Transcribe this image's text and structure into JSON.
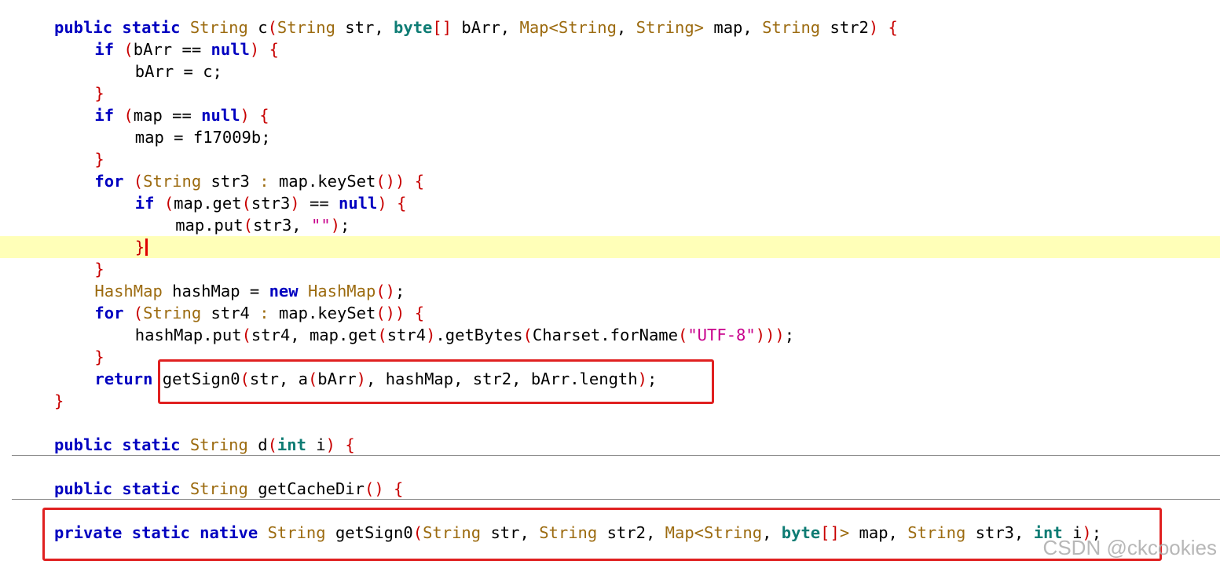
{
  "editor": {
    "highlight_line": 10,
    "caret_line": 10,
    "lines": [
      {
        "indent": 1,
        "tokens": [
          [
            "kw",
            "public"
          ],
          [
            "pl",
            " "
          ],
          [
            "kw",
            "static"
          ],
          [
            "pl",
            " "
          ],
          [
            "ty",
            "String"
          ],
          [
            "pl",
            " c"
          ],
          [
            "br",
            "("
          ],
          [
            "ty",
            "String"
          ],
          [
            "pl",
            " str, "
          ],
          [
            "pr",
            "byte"
          ],
          [
            "br",
            "[]"
          ],
          [
            "pl",
            " bArr, "
          ],
          [
            "ty",
            "Map<String"
          ],
          [
            "pl",
            ", "
          ],
          [
            "ty",
            "String>"
          ],
          [
            "pl",
            " map, "
          ],
          [
            "ty",
            "String"
          ],
          [
            "pl",
            " str2"
          ],
          [
            "br",
            ")"
          ],
          [
            "pl",
            " "
          ],
          [
            "br",
            "{"
          ]
        ]
      },
      {
        "indent": 2,
        "tokens": [
          [
            "kw",
            "if"
          ],
          [
            "pl",
            " "
          ],
          [
            "br",
            "("
          ],
          [
            "pl",
            "bArr == "
          ],
          [
            "kw",
            "null"
          ],
          [
            "br",
            ")"
          ],
          [
            "pl",
            " "
          ],
          [
            "br",
            "{"
          ]
        ]
      },
      {
        "indent": 3,
        "tokens": [
          [
            "pl",
            "bArr = c;"
          ]
        ]
      },
      {
        "indent": 2,
        "tokens": [
          [
            "br",
            "}"
          ]
        ]
      },
      {
        "indent": 2,
        "tokens": [
          [
            "kw",
            "if"
          ],
          [
            "pl",
            " "
          ],
          [
            "br",
            "("
          ],
          [
            "pl",
            "map == "
          ],
          [
            "kw",
            "null"
          ],
          [
            "br",
            ")"
          ],
          [
            "pl",
            " "
          ],
          [
            "br",
            "{"
          ]
        ]
      },
      {
        "indent": 3,
        "tokens": [
          [
            "pl",
            "map = f17009b;"
          ]
        ]
      },
      {
        "indent": 2,
        "tokens": [
          [
            "br",
            "}"
          ]
        ]
      },
      {
        "indent": 2,
        "tokens": [
          [
            "kw",
            "for"
          ],
          [
            "pl",
            " "
          ],
          [
            "br",
            "("
          ],
          [
            "ty",
            "String"
          ],
          [
            "pl",
            " str3 "
          ],
          [
            "ty",
            ":"
          ],
          [
            "pl",
            " map.keySet"
          ],
          [
            "br",
            "())"
          ],
          [
            "pl",
            " "
          ],
          [
            "br",
            "{"
          ]
        ]
      },
      {
        "indent": 3,
        "tokens": [
          [
            "kw",
            "if"
          ],
          [
            "pl",
            " "
          ],
          [
            "br",
            "("
          ],
          [
            "pl",
            "map.get"
          ],
          [
            "br",
            "("
          ],
          [
            "pl",
            "str3"
          ],
          [
            "br",
            ")"
          ],
          [
            "pl",
            " == "
          ],
          [
            "kw",
            "null"
          ],
          [
            "br",
            ")"
          ],
          [
            "pl",
            " "
          ],
          [
            "br",
            "{"
          ]
        ]
      },
      {
        "indent": 4,
        "tokens": [
          [
            "pl",
            "map.put"
          ],
          [
            "br",
            "("
          ],
          [
            "pl",
            "str3, "
          ],
          [
            "st",
            "\"\""
          ],
          [
            "br",
            ")"
          ],
          [
            "pl",
            ";"
          ]
        ]
      },
      {
        "indent": 3,
        "tokens": [
          [
            "br",
            "}"
          ]
        ]
      },
      {
        "indent": 2,
        "tokens": [
          [
            "br",
            "}"
          ]
        ]
      },
      {
        "indent": 2,
        "tokens": [
          [
            "ty",
            "HashMap"
          ],
          [
            "pl",
            " hashMap = "
          ],
          [
            "kw",
            "new"
          ],
          [
            "pl",
            " "
          ],
          [
            "ty",
            "HashMap"
          ],
          [
            "br",
            "()"
          ],
          [
            "pl",
            ";"
          ]
        ]
      },
      {
        "indent": 2,
        "tokens": [
          [
            "kw",
            "for"
          ],
          [
            "pl",
            " "
          ],
          [
            "br",
            "("
          ],
          [
            "ty",
            "String"
          ],
          [
            "pl",
            " str4 "
          ],
          [
            "ty",
            ":"
          ],
          [
            "pl",
            " map.keySet"
          ],
          [
            "br",
            "())"
          ],
          [
            "pl",
            " "
          ],
          [
            "br",
            "{"
          ]
        ]
      },
      {
        "indent": 3,
        "tokens": [
          [
            "pl",
            "hashMap.put"
          ],
          [
            "br",
            "("
          ],
          [
            "pl",
            "str4, map.get"
          ],
          [
            "br",
            "("
          ],
          [
            "pl",
            "str4"
          ],
          [
            "br",
            ")"
          ],
          [
            "pl",
            ".getBytes"
          ],
          [
            "br",
            "("
          ],
          [
            "pl",
            "Charset.forName"
          ],
          [
            "br",
            "("
          ],
          [
            "st",
            "\"UTF-8\""
          ],
          [
            "br",
            ")))"
          ],
          [
            "pl",
            ";"
          ]
        ]
      },
      {
        "indent": 2,
        "tokens": [
          [
            "br",
            "}"
          ]
        ]
      },
      {
        "indent": 2,
        "tokens": [
          [
            "kw",
            "return"
          ],
          [
            "pl",
            " getSign0"
          ],
          [
            "br",
            "("
          ],
          [
            "pl",
            "str, a"
          ],
          [
            "br",
            "("
          ],
          [
            "pl",
            "bArr"
          ],
          [
            "br",
            ")"
          ],
          [
            "pl",
            ", hashMap, str2, bArr.length"
          ],
          [
            "br",
            ")"
          ],
          [
            "pl",
            ";"
          ]
        ]
      },
      {
        "indent": 1,
        "tokens": [
          [
            "br",
            "}"
          ]
        ]
      },
      {
        "indent": 1,
        "tokens": []
      },
      {
        "indent": 1,
        "tokens": [
          [
            "kw",
            "public"
          ],
          [
            "pl",
            " "
          ],
          [
            "kw",
            "static"
          ],
          [
            "pl",
            " "
          ],
          [
            "ty",
            "String"
          ],
          [
            "pl",
            " d"
          ],
          [
            "br",
            "("
          ],
          [
            "pr",
            "int"
          ],
          [
            "pl",
            " i"
          ],
          [
            "br",
            ")"
          ],
          [
            "pl",
            " "
          ],
          [
            "br",
            "{"
          ]
        ]
      },
      {
        "indent": 1,
        "tokens": []
      },
      {
        "indent": 1,
        "tokens": [
          [
            "kw",
            "public"
          ],
          [
            "pl",
            " "
          ],
          [
            "kw",
            "static"
          ],
          [
            "pl",
            " "
          ],
          [
            "ty",
            "String"
          ],
          [
            "pl",
            " getCacheDir"
          ],
          [
            "br",
            "()"
          ],
          [
            "pl",
            " "
          ],
          [
            "br",
            "{"
          ]
        ]
      },
      {
        "indent": 1,
        "tokens": []
      },
      {
        "indent": 1,
        "tokens": [
          [
            "kw",
            "private"
          ],
          [
            "pl",
            " "
          ],
          [
            "kw",
            "static"
          ],
          [
            "pl",
            " "
          ],
          [
            "kw",
            "native"
          ],
          [
            "pl",
            " "
          ],
          [
            "ty",
            "String"
          ],
          [
            "pl",
            " getSign0"
          ],
          [
            "br",
            "("
          ],
          [
            "ty",
            "String"
          ],
          [
            "pl",
            " str, "
          ],
          [
            "ty",
            "String"
          ],
          [
            "pl",
            " str2, "
          ],
          [
            "ty",
            "Map<String"
          ],
          [
            "pl",
            ", "
          ],
          [
            "pr",
            "byte"
          ],
          [
            "br",
            "[]"
          ],
          [
            "ty",
            ">"
          ],
          [
            "pl",
            " map, "
          ],
          [
            "ty",
            "String"
          ],
          [
            "pl",
            " str3, "
          ],
          [
            "pr",
            "int"
          ],
          [
            "pl",
            " i"
          ],
          [
            "br",
            ")"
          ],
          [
            "pl",
            ";"
          ]
        ]
      }
    ]
  },
  "watermark": "CSDN @ckcookies"
}
